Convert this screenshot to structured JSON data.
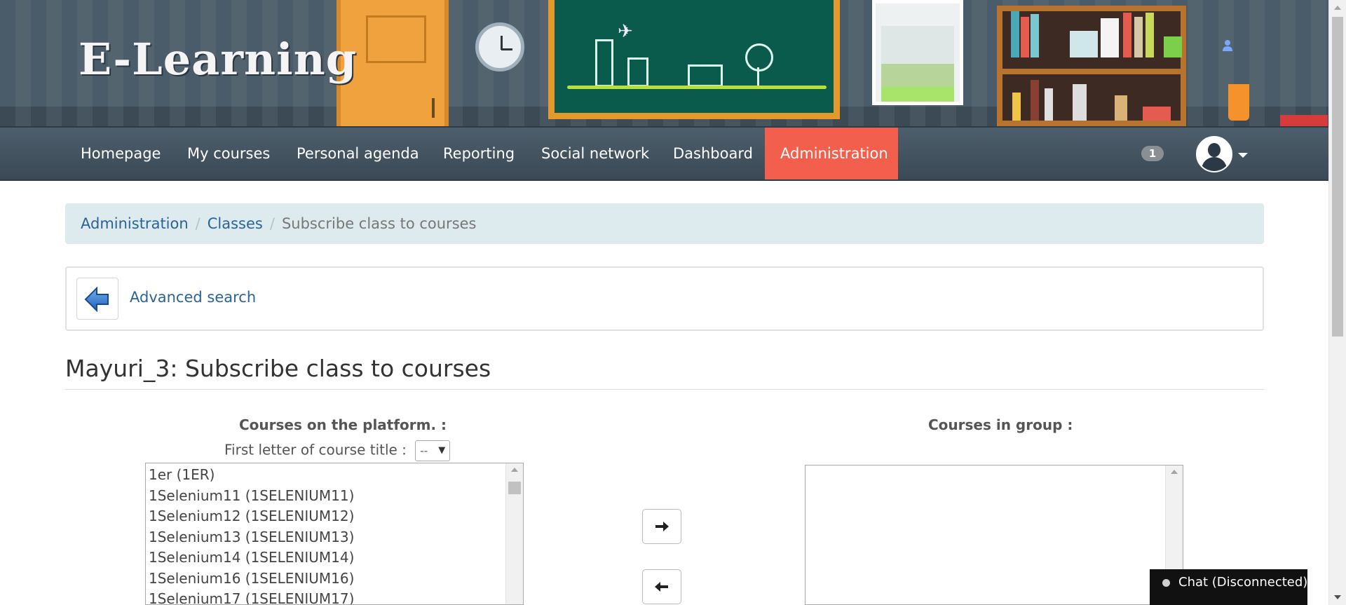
{
  "banner": {
    "logo_text": "E-Learning",
    "user_icon": "user-icon"
  },
  "nav": {
    "items": [
      {
        "label": "Homepage"
      },
      {
        "label": "My courses"
      },
      {
        "label": "Personal agenda"
      },
      {
        "label": "Reporting"
      },
      {
        "label": "Social network"
      },
      {
        "label": "Dashboard"
      },
      {
        "label": "Administration",
        "active": true
      }
    ],
    "active_color": "#f2604d",
    "notification_count": "1",
    "avatar_icon": "user-avatar-icon"
  },
  "breadcrumb": {
    "items": [
      "Administration",
      "Classes"
    ],
    "current": "Subscribe class to courses",
    "separator": "/"
  },
  "toolbar": {
    "back_icon": "back-arrow-icon",
    "advanced_search": "Advanced search"
  },
  "page": {
    "title": "Mayuri_3: Subscribe class to courses"
  },
  "platform_courses": {
    "heading": "Courses on the platform. :",
    "letter_label": "First letter of course title :",
    "letter_value": "--",
    "options": [
      "1er (1ER)",
      "1Selenium11 (1SELENIUM11)",
      "1Selenium12 (1SELENIUM12)",
      "1Selenium13 (1SELENIUM13)",
      "1Selenium14 (1SELENIUM14)",
      "1Selenium16 (1SELENIUM16)",
      "1Selenium17 (1SELENIUM17)"
    ]
  },
  "group_courses": {
    "heading": "Courses in group :",
    "options": []
  },
  "buttons": {
    "add": "🡒",
    "remove": "🡐"
  },
  "chat": {
    "label": "Chat (Disconnected)"
  }
}
